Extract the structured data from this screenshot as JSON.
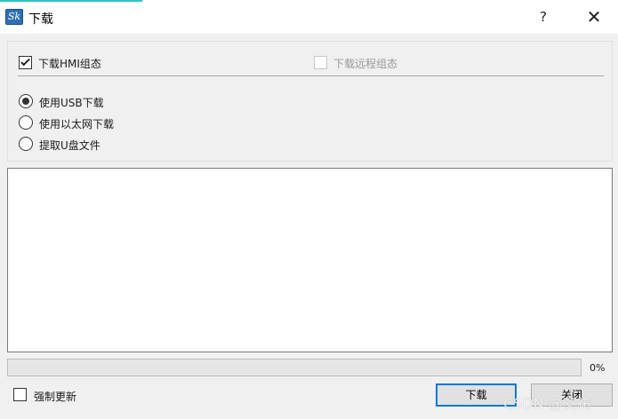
{
  "window": {
    "title": "下载",
    "icon_text": "Sk",
    "help_glyph": "?",
    "close_glyph": "✕"
  },
  "options": {
    "download_hmi": {
      "label": "下载HMI组态",
      "checked": true
    },
    "download_remote": {
      "label": "下载远程组态",
      "checked": false,
      "enabled": false
    },
    "modes": [
      {
        "label": "使用USB下载",
        "selected": true
      },
      {
        "label": "使用以太网下载",
        "selected": false
      },
      {
        "label": "提取U盘文件",
        "selected": false
      }
    ]
  },
  "log": {
    "text": ""
  },
  "progress": {
    "value": 0,
    "text": "0%"
  },
  "footer": {
    "force_update": {
      "label": "强制更新",
      "checked": false
    },
    "download_button": "下载",
    "close_button": "关闭"
  },
  "watermark": "CSDN @艾祐",
  "colors": {
    "accent": "#0078d7",
    "progress": "#06b025",
    "strip": "#2ec5c5"
  }
}
